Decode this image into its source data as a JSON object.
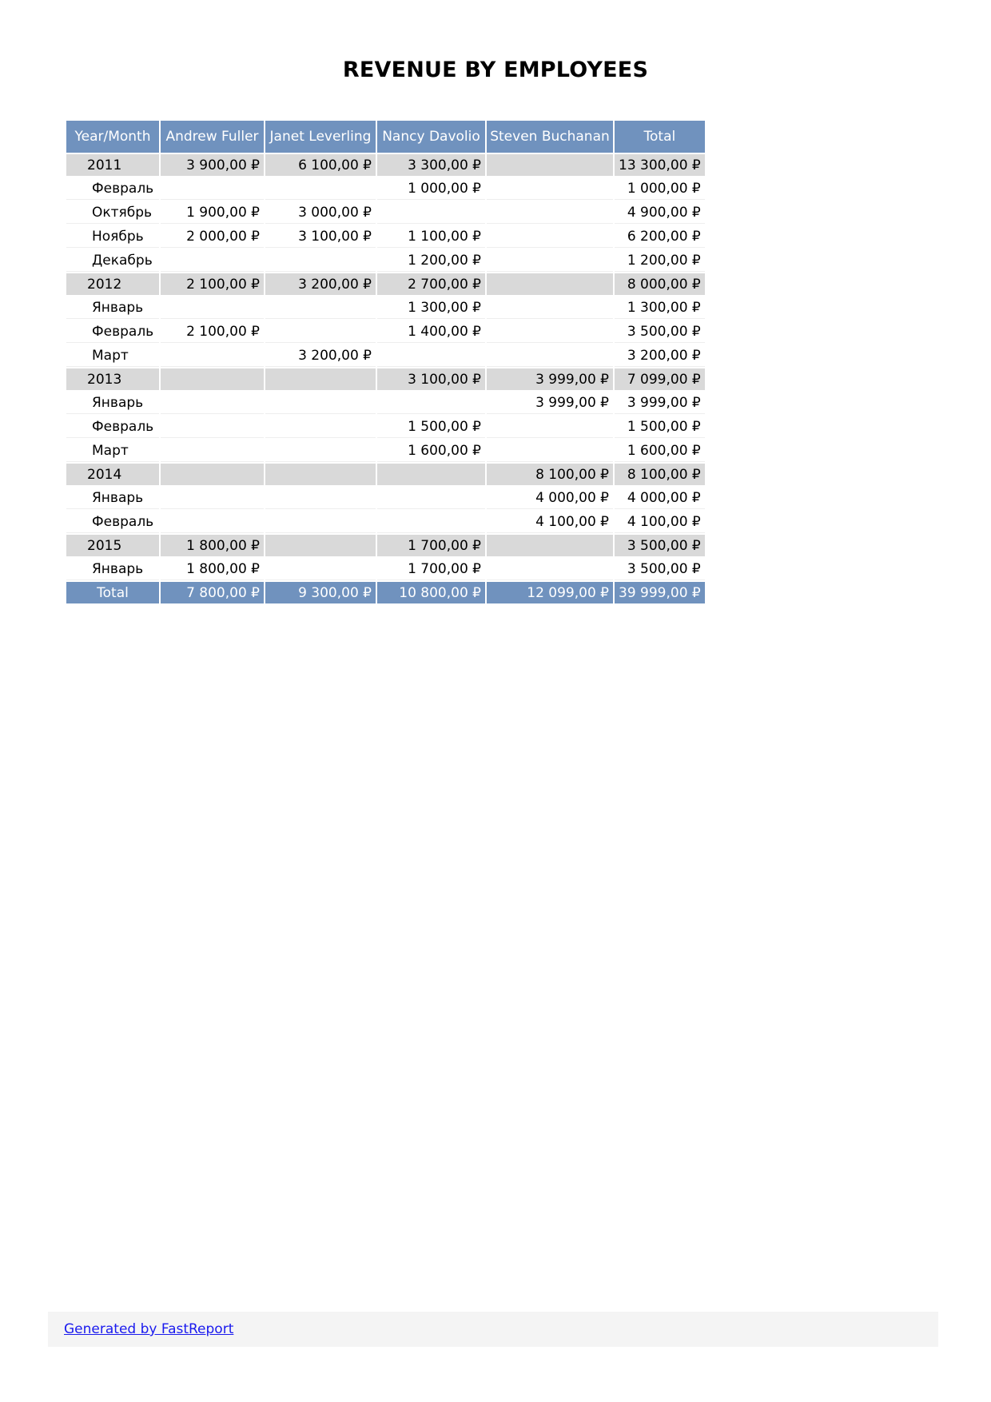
{
  "report": {
    "title": "REVENUE BY EMPLOYEES"
  },
  "table": {
    "headers": [
      "Year/Month",
      "Andrew Fuller",
      "Janet Leverling",
      "Nancy Davolio",
      "Steven Buchanan",
      "Total"
    ],
    "rows": [
      {
        "type": "year",
        "label": "2011",
        "cells": [
          "3 900,00 ₽",
          "6 100,00 ₽",
          "3 300,00 ₽",
          "",
          "13 300,00 ₽"
        ]
      },
      {
        "type": "month",
        "label": "Февраль",
        "cells": [
          "",
          "",
          "1 000,00 ₽",
          "",
          "1 000,00 ₽"
        ]
      },
      {
        "type": "month",
        "label": "Октябрь",
        "cells": [
          "1 900,00 ₽",
          "3 000,00 ₽",
          "",
          "",
          "4 900,00 ₽"
        ]
      },
      {
        "type": "month",
        "label": "Ноябрь",
        "cells": [
          "2 000,00 ₽",
          "3 100,00 ₽",
          "1 100,00 ₽",
          "",
          "6 200,00 ₽"
        ]
      },
      {
        "type": "month",
        "label": "Декабрь",
        "cells": [
          "",
          "",
          "1 200,00 ₽",
          "",
          "1 200,00 ₽"
        ]
      },
      {
        "type": "year",
        "label": "2012",
        "cells": [
          "2 100,00 ₽",
          "3 200,00 ₽",
          "2 700,00 ₽",
          "",
          "8 000,00 ₽"
        ]
      },
      {
        "type": "month",
        "label": "Январь",
        "cells": [
          "",
          "",
          "1 300,00 ₽",
          "",
          "1 300,00 ₽"
        ]
      },
      {
        "type": "month",
        "label": "Февраль",
        "cells": [
          "2 100,00 ₽",
          "",
          "1 400,00 ₽",
          "",
          "3 500,00 ₽"
        ]
      },
      {
        "type": "month",
        "label": "Март",
        "cells": [
          "",
          "3 200,00 ₽",
          "",
          "",
          "3 200,00 ₽"
        ]
      },
      {
        "type": "year",
        "label": "2013",
        "cells": [
          "",
          "",
          "3 100,00 ₽",
          "3 999,00 ₽",
          "7 099,00 ₽"
        ]
      },
      {
        "type": "month",
        "label": "Январь",
        "cells": [
          "",
          "",
          "",
          "3 999,00 ₽",
          "3 999,00 ₽"
        ]
      },
      {
        "type": "month",
        "label": "Февраль",
        "cells": [
          "",
          "",
          "1 500,00 ₽",
          "",
          "1 500,00 ₽"
        ]
      },
      {
        "type": "month",
        "label": "Март",
        "cells": [
          "",
          "",
          "1 600,00 ₽",
          "",
          "1 600,00 ₽"
        ]
      },
      {
        "type": "year",
        "label": "2014",
        "cells": [
          "",
          "",
          "",
          "8 100,00 ₽",
          "8 100,00 ₽"
        ]
      },
      {
        "type": "month",
        "label": "Январь",
        "cells": [
          "",
          "",
          "",
          "4 000,00 ₽",
          "4 000,00 ₽"
        ]
      },
      {
        "type": "month",
        "label": "Февраль",
        "cells": [
          "",
          "",
          "",
          "4 100,00 ₽",
          "4 100,00 ₽"
        ]
      },
      {
        "type": "year",
        "label": "2015",
        "cells": [
          "1 800,00 ₽",
          "",
          "1 700,00 ₽",
          "",
          "3 500,00 ₽"
        ]
      },
      {
        "type": "month",
        "label": "Январь",
        "cells": [
          "1 800,00 ₽",
          "",
          "1 700,00 ₽",
          "",
          "3 500,00 ₽"
        ]
      }
    ],
    "total": {
      "label": "Total",
      "cells": [
        "7 800,00 ₽",
        "9 300,00 ₽",
        "10 800,00 ₽",
        "12 099,00 ₽",
        "39 999,00 ₽"
      ]
    }
  },
  "footer": {
    "link_text": "Generated by FastReport"
  },
  "colors": {
    "header_bg": "#7092be",
    "year_row_bg": "#d9d9d9",
    "link": "#1a1aee",
    "footer_bg": "#f4f4f4"
  }
}
